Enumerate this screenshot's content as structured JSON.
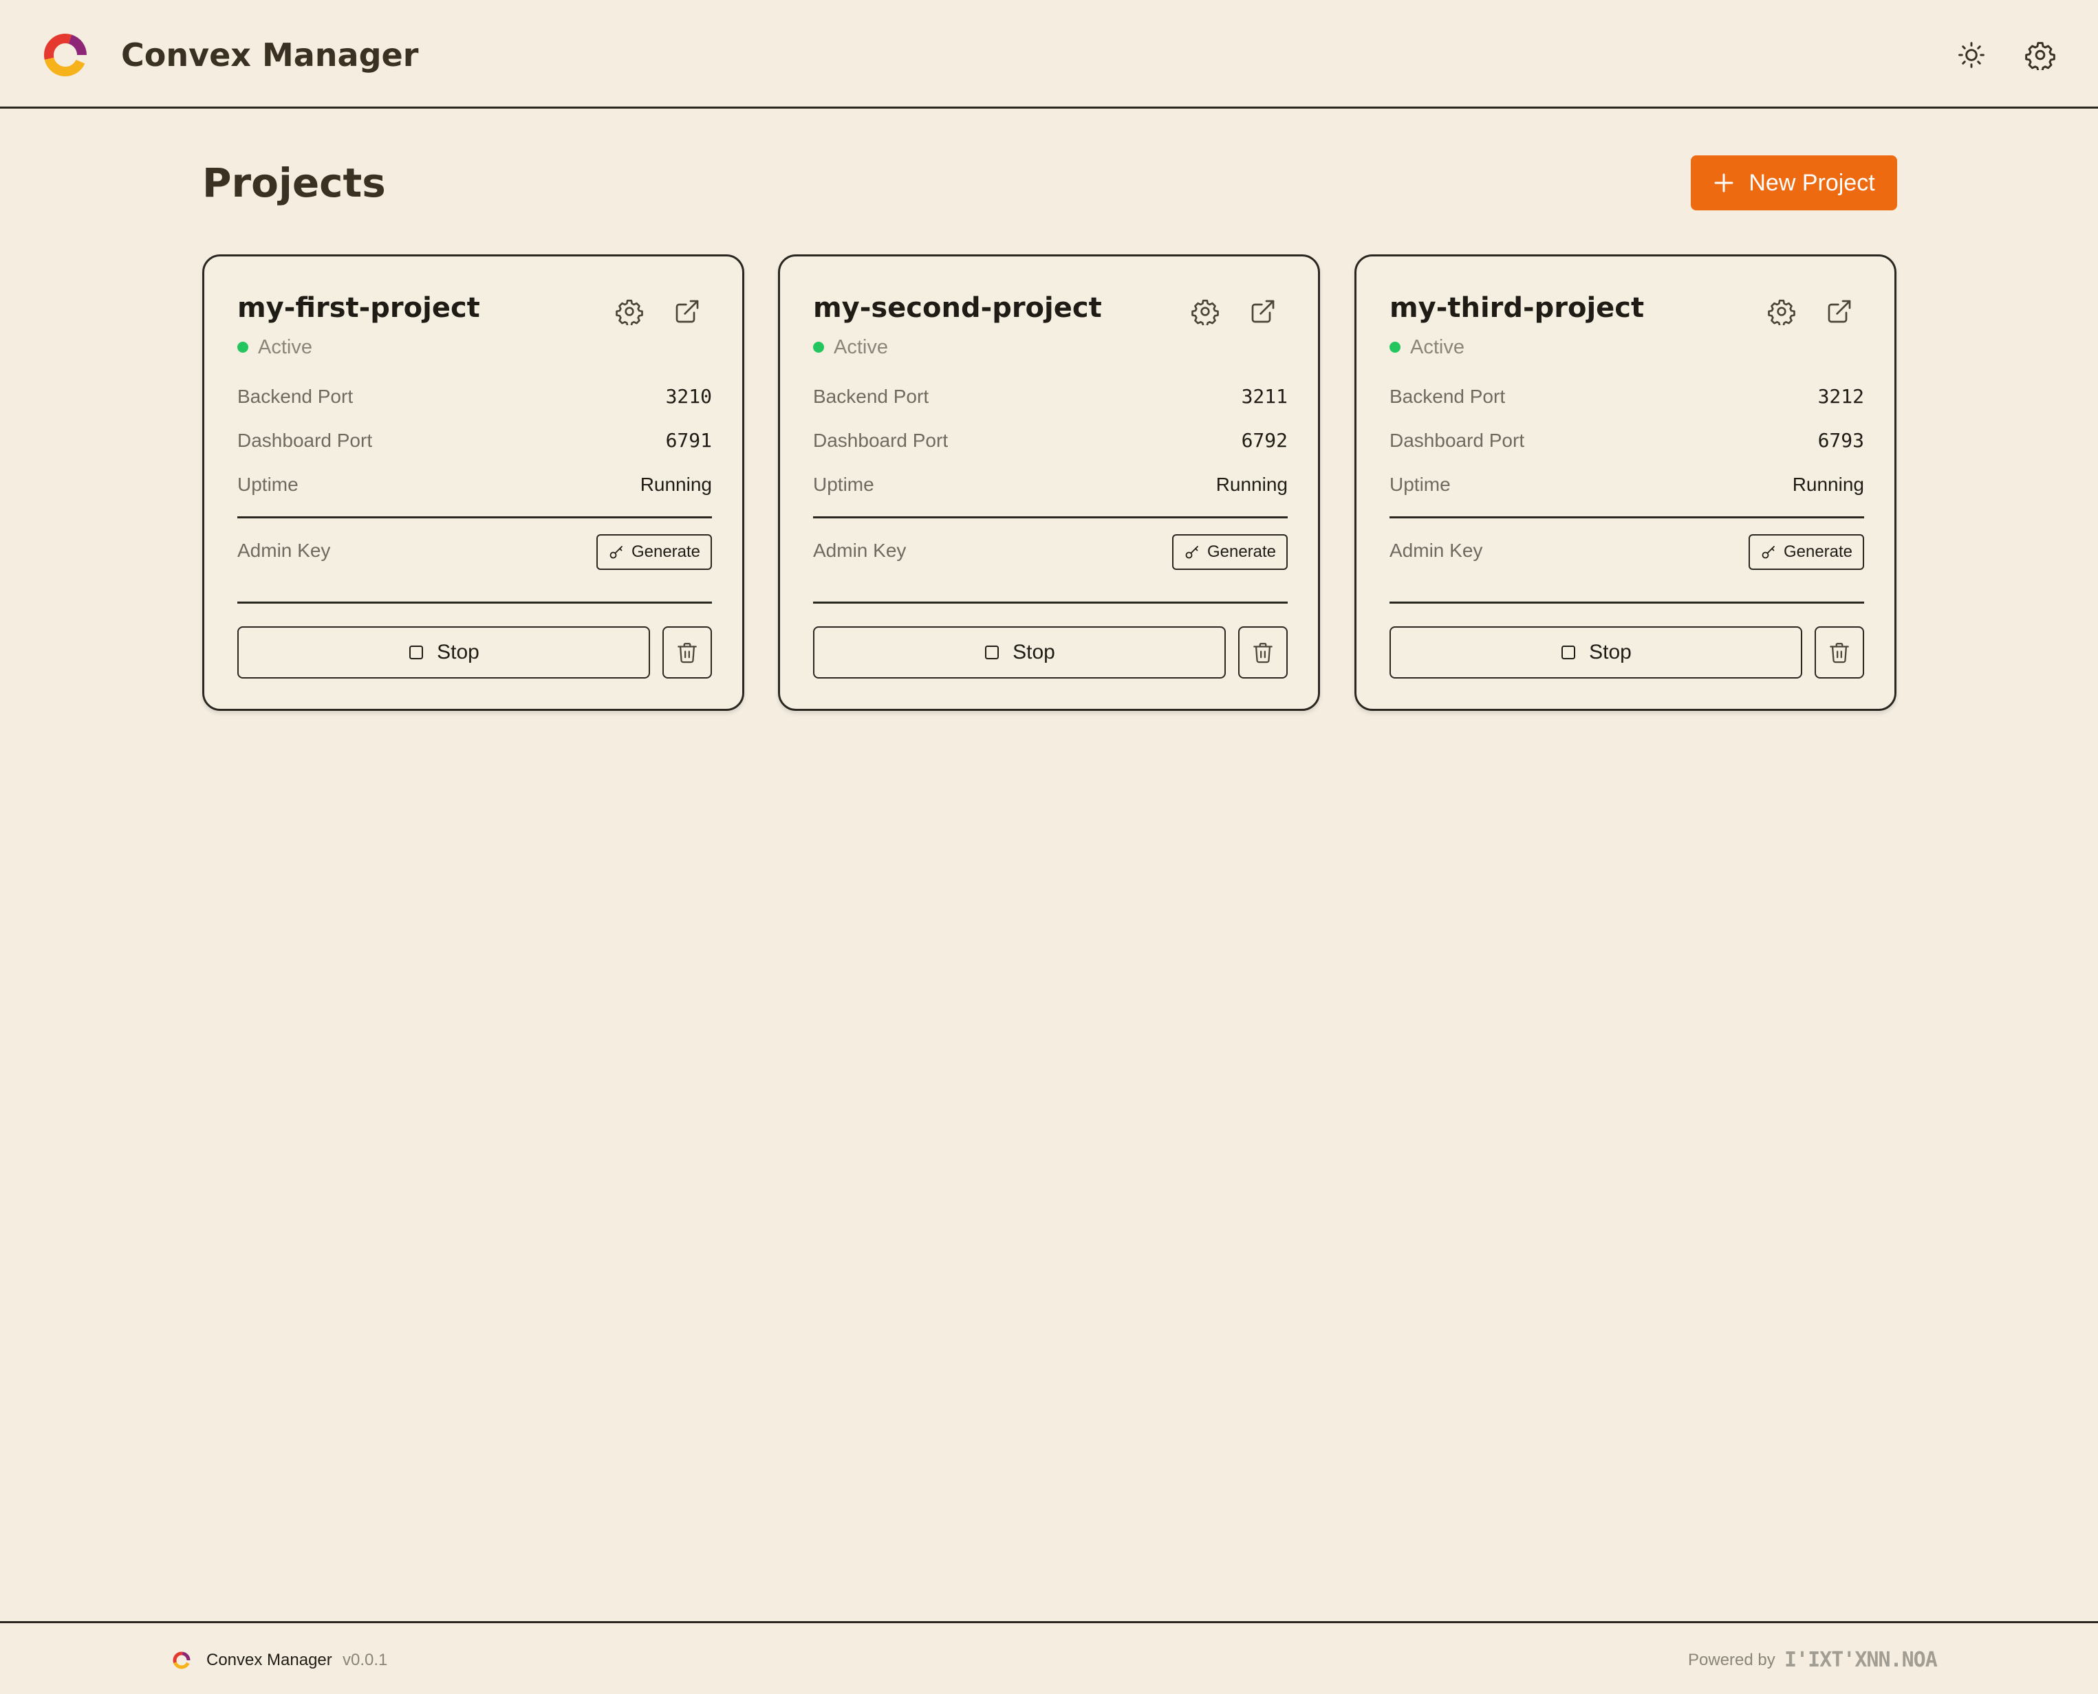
{
  "header": {
    "app_title": "Convex Manager",
    "icons": {
      "logo": "convex-logo-icon",
      "theme": "sun-icon",
      "settings": "gear-icon"
    }
  },
  "main": {
    "title": "Projects",
    "new_project_label": "New Project",
    "new_project_icon": "plus-icon"
  },
  "projects": [
    {
      "name": "my-first-project",
      "status": "Active",
      "backend_port_label": "Backend Port",
      "backend_port": "3210",
      "dashboard_port_label": "Dashboard Port",
      "dashboard_port": "6791",
      "uptime_label": "Uptime",
      "uptime": "Running",
      "admin_key_label": "Admin Key",
      "generate_label": "Generate",
      "stop_label": "Stop"
    },
    {
      "name": "my-second-project",
      "status": "Active",
      "backend_port_label": "Backend Port",
      "backend_port": "3211",
      "dashboard_port_label": "Dashboard Port",
      "dashboard_port": "6792",
      "uptime_label": "Uptime",
      "uptime": "Running",
      "admin_key_label": "Admin Key",
      "generate_label": "Generate",
      "stop_label": "Stop"
    },
    {
      "name": "my-third-project",
      "status": "Active",
      "backend_port_label": "Backend Port",
      "backend_port": "3212",
      "dashboard_port_label": "Dashboard Port",
      "dashboard_port": "6793",
      "uptime_label": "Uptime",
      "uptime": "Running",
      "admin_key_label": "Admin Key",
      "generate_label": "Generate",
      "stop_label": "Stop"
    }
  ],
  "footer": {
    "app_name": "Convex Manager",
    "version": "v0.0.1",
    "powered_by": "Powered by",
    "powered_logo_text": "I'IXT'XNN.NOA"
  },
  "colors": {
    "background": "#f4ede0",
    "accent": "#ee6a10",
    "status_active": "#22c55e",
    "text_primary": "#1f1c16",
    "text_muted": "#8a8579",
    "border": "#2a2620"
  }
}
